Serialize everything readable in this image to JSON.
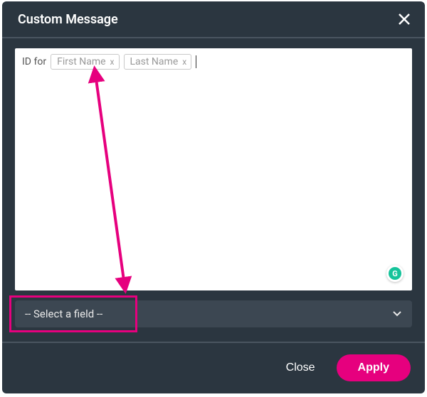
{
  "modal": {
    "title": "Custom Message"
  },
  "editor": {
    "prefix": "ID for",
    "tokens": [
      {
        "label": "First Name"
      },
      {
        "label": "Last Name"
      }
    ]
  },
  "select": {
    "placeholder": "-- Select a field --"
  },
  "footer": {
    "close": "Close",
    "apply": "Apply"
  },
  "badge": {
    "letter": "G"
  },
  "token_remove_glyph": "x"
}
